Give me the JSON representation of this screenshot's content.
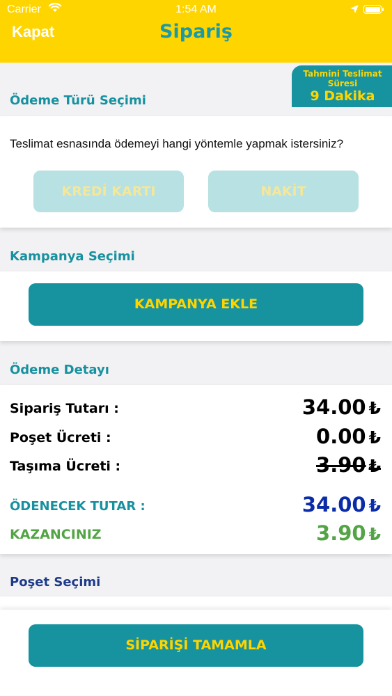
{
  "status_bar": {
    "carrier": "Carrier",
    "time": "1:54 AM"
  },
  "header": {
    "close_label": "Kapat",
    "title": "Sipariş"
  },
  "eta": {
    "line1": "Tahmini Teslimat",
    "line2": "Süresi",
    "value": "9 Dakika"
  },
  "payment": {
    "section_title": "Ödeme Türü Seçimi",
    "question": "Teslimat esnasında ödemeyi hangi yöntemle yapmak istersiniz?",
    "options": [
      "KREDİ KARTI",
      "NAKİT"
    ]
  },
  "campaign": {
    "section_title": "Kampanya Seçimi",
    "button_label": "KAMPANYA EKLE"
  },
  "details": {
    "section_title": "Ödeme Detayı",
    "currency": "₺",
    "rows": [
      {
        "label": "Sipariş Tutarı :",
        "value": "34.00"
      },
      {
        "label": "Poşet Ücreti :",
        "value": "0.00"
      },
      {
        "label": "Taşıma Ücreti :",
        "value": "3.90"
      }
    ],
    "total_label": "ÖDENECEK TUTAR :",
    "total_value": "34.00",
    "saving_label": "KAZANCINIZ",
    "saving_value": "3.90"
  },
  "bag": {
    "section_title": "Poşet Seçimi"
  },
  "footer": {
    "complete_label": "SİPARİŞİ TAMAMLA"
  },
  "colors": {
    "brand_yellow": "#ffd500",
    "brand_teal": "#17939f",
    "total_blue": "#0a2ca8",
    "saving_green": "#52a445"
  },
  "icons": [
    "wifi-icon",
    "location-icon",
    "battery-icon"
  ]
}
